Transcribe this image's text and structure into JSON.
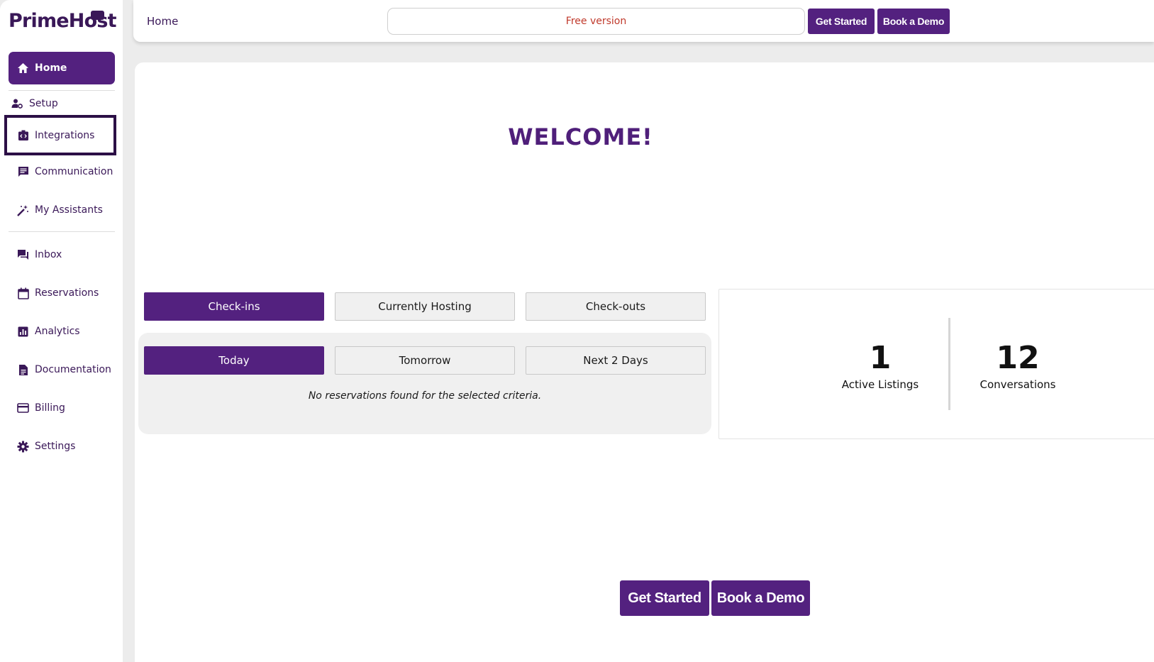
{
  "brand": {
    "name": "PrimeHost"
  },
  "sidebar": {
    "items": [
      {
        "label": "Home",
        "icon": "home-icon"
      },
      {
        "label": "Setup",
        "icon": "user-gear-icon"
      },
      {
        "label": "Integrations",
        "icon": "integrations-icon"
      },
      {
        "label": "Communication",
        "icon": "chat-icon"
      },
      {
        "label": "My Assistants",
        "icon": "magic-wand-icon"
      },
      {
        "label": "Inbox",
        "icon": "inbox-icon"
      },
      {
        "label": "Reservations",
        "icon": "calendar-icon"
      },
      {
        "label": "Analytics",
        "icon": "analytics-icon"
      },
      {
        "label": "Documentation",
        "icon": "document-icon"
      },
      {
        "label": "Billing",
        "icon": "credit-card-icon"
      },
      {
        "label": "Settings",
        "icon": "gear-icon"
      }
    ]
  },
  "header": {
    "breadcrumb": "Home",
    "plan_notice": "Free version",
    "get_started": "Get Started",
    "book_demo": "Book a Demo"
  },
  "main": {
    "welcome": "WELCOME!",
    "type_tabs": [
      "Check-ins",
      "Currently Hosting",
      "Check-outs"
    ],
    "day_tabs": [
      "Today",
      "Tomorrow",
      "Next 2 Days"
    ],
    "empty_message": "No reservations found for the selected criteria.",
    "stats": [
      {
        "value": "1",
        "label": "Active Listings"
      },
      {
        "value": "12",
        "label": "Conversations"
      }
    ],
    "cta_get_started": "Get Started",
    "cta_book_demo": "Book a Demo"
  },
  "colors": {
    "accent": "#53217f",
    "notice": "#c0392b",
    "text": "#3a1858"
  }
}
